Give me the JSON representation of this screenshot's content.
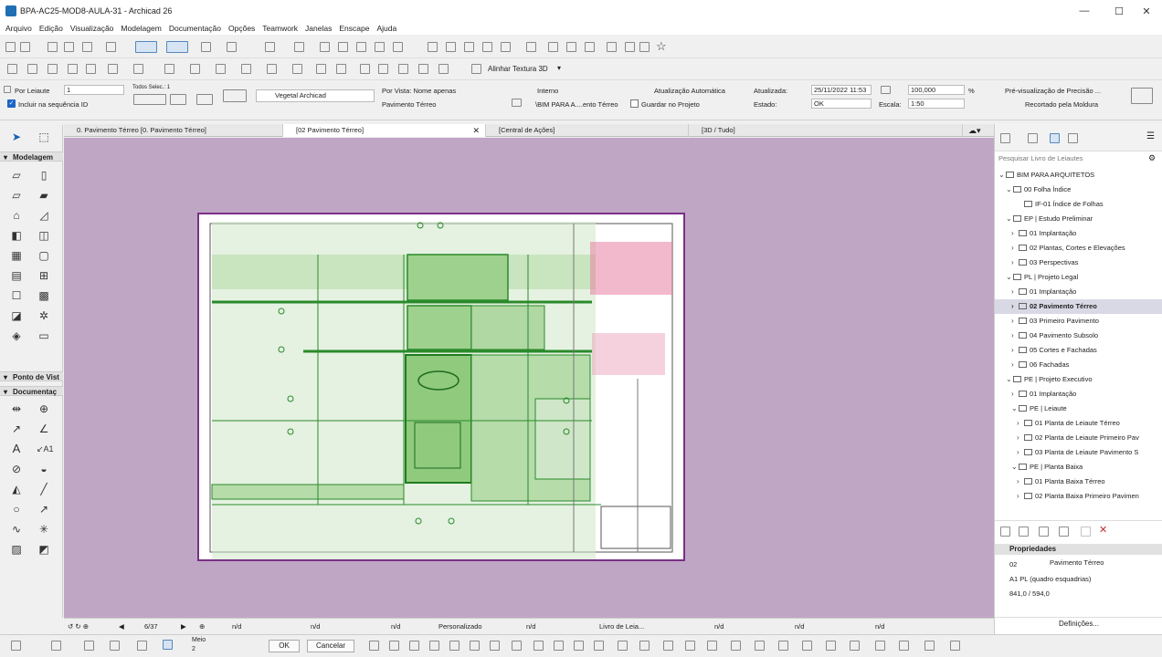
{
  "window": {
    "title": "BPA-AC25-MOD8-AULA-31 - Archicad 26",
    "minimize": "—",
    "maximize": "☐",
    "close": "✕"
  },
  "menu": [
    "Arquivo",
    "Edição",
    "Visualização",
    "Modelagem",
    "Documentação",
    "Opções",
    "Teamwork",
    "Janelas",
    "Enscape",
    "Ajuda"
  ],
  "toolbar2": {
    "align_texture_label": "Alinhar Textura 3D"
  },
  "infobox": {
    "by_layout_label": "Por Leiaute",
    "layout_number": "1",
    "include_id_label": "Incluir na sequência ID",
    "all_selected_label": "Todos Selec.: 1",
    "layer_value": "Vegetal Archicad",
    "by_view_label": "Por Vista: Nome apenas",
    "view_name": "Pavimento Térreo",
    "status_value": "Interno",
    "source_path": "\\BIM PARA A....ento Térreo",
    "auto_update_label": "Atualização Automática",
    "save_in_project_label": "Guardar no Projeto",
    "updated_label": "Atualizada:",
    "updated_value": "25/11/2022 11:53",
    "state_label": "Estado:",
    "state_value": "OK",
    "zoom_value": "100,000",
    "zoom_unit": "%",
    "scale_label": "Escala:",
    "scale_value": "1:50",
    "precision_preview": "Pré-visualização de Precisão ...",
    "cropped_by_frame": "Recortado pela Moldura"
  },
  "toolbox": {
    "sections": [
      "Modelagem",
      "Ponto de Vist",
      "Documentaç"
    ]
  },
  "tabs": [
    {
      "label": "0. Pavimento Térreo [0. Pavimento Térreo]"
    },
    {
      "label": "[02 Pavimento Térreo]",
      "close": "✕"
    },
    {
      "label": "[Central de Ações]"
    },
    {
      "label": "[3D / Tudo]"
    }
  ],
  "navigator": {
    "search_placeholder": "Pesquisar Livro de Leiautes",
    "items": [
      {
        "label": "BIM PARA ARQUITETOS",
        "arrow": "⌄",
        "selected": false
      },
      {
        "label": "00 Folha Índice",
        "arrow": "⌄",
        "selected": false
      },
      {
        "label": "IF-01 Índice de Folhas",
        "arrow": "",
        "selected": false
      },
      {
        "label": "EP | Estudo Preliminar",
        "arrow": "⌄",
        "selected": false
      },
      {
        "label": "01 Implantação",
        "arrow": "›",
        "selected": false
      },
      {
        "label": "02 Plantas, Cortes e Elevações",
        "arrow": "›",
        "selected": false
      },
      {
        "label": "03 Perspectivas",
        "arrow": "›",
        "selected": false
      },
      {
        "label": "PL | Projeto Legal",
        "arrow": "⌄",
        "selected": false
      },
      {
        "label": "01 Implantação",
        "arrow": "›",
        "selected": false
      },
      {
        "label": "02 Pavimento Térreo",
        "arrow": "›",
        "selected": true
      },
      {
        "label": "03 Primeiro Pavimento",
        "arrow": "›",
        "selected": false
      },
      {
        "label": "04 Pavimento Subsolo",
        "arrow": "›",
        "selected": false
      },
      {
        "label": "05 Cortes e Fachadas",
        "arrow": "›",
        "selected": false
      },
      {
        "label": "06 Fachadas",
        "arrow": "›",
        "selected": false
      },
      {
        "label": "PE | Projeto Executivo",
        "arrow": "⌄",
        "selected": false
      },
      {
        "label": "01 Implantação",
        "arrow": "›",
        "selected": false
      },
      {
        "label": "PE | Leiaute",
        "arrow": "⌄",
        "selected": false
      },
      {
        "label": "01 Planta de Leiaute Térreo",
        "arrow": "›",
        "selected": false
      },
      {
        "label": "02 Planta de Leiaute Primeiro Pav",
        "arrow": "›",
        "selected": false
      },
      {
        "label": "03 Planta de Leiaute Pavimento S",
        "arrow": "›",
        "selected": false
      },
      {
        "label": "PE | Planta Baixa",
        "arrow": "⌄",
        "selected": false
      },
      {
        "label": "01 Planta Baixa Térreo",
        "arrow": "›",
        "selected": false
      },
      {
        "label": "02 Planta Baixa Primeiro Pavimen",
        "arrow": "›",
        "selected": false
      }
    ]
  },
  "properties": {
    "header": "Propriedades",
    "id": "02",
    "name": "Pavimento Térreo",
    "master": "A1 PL (quadro esquadrias)",
    "size": "841,0 / 594,0",
    "settings_button": "Definições..."
  },
  "statusbar": {
    "page": "6/37",
    "nd": "n/d",
    "custom": "Personalizado",
    "layout_book": "Livro de Leia..."
  },
  "bottombar": {
    "mid_label": "Meio",
    "mid_value": "2",
    "ok": "OK",
    "cancel": "Cancelar"
  }
}
